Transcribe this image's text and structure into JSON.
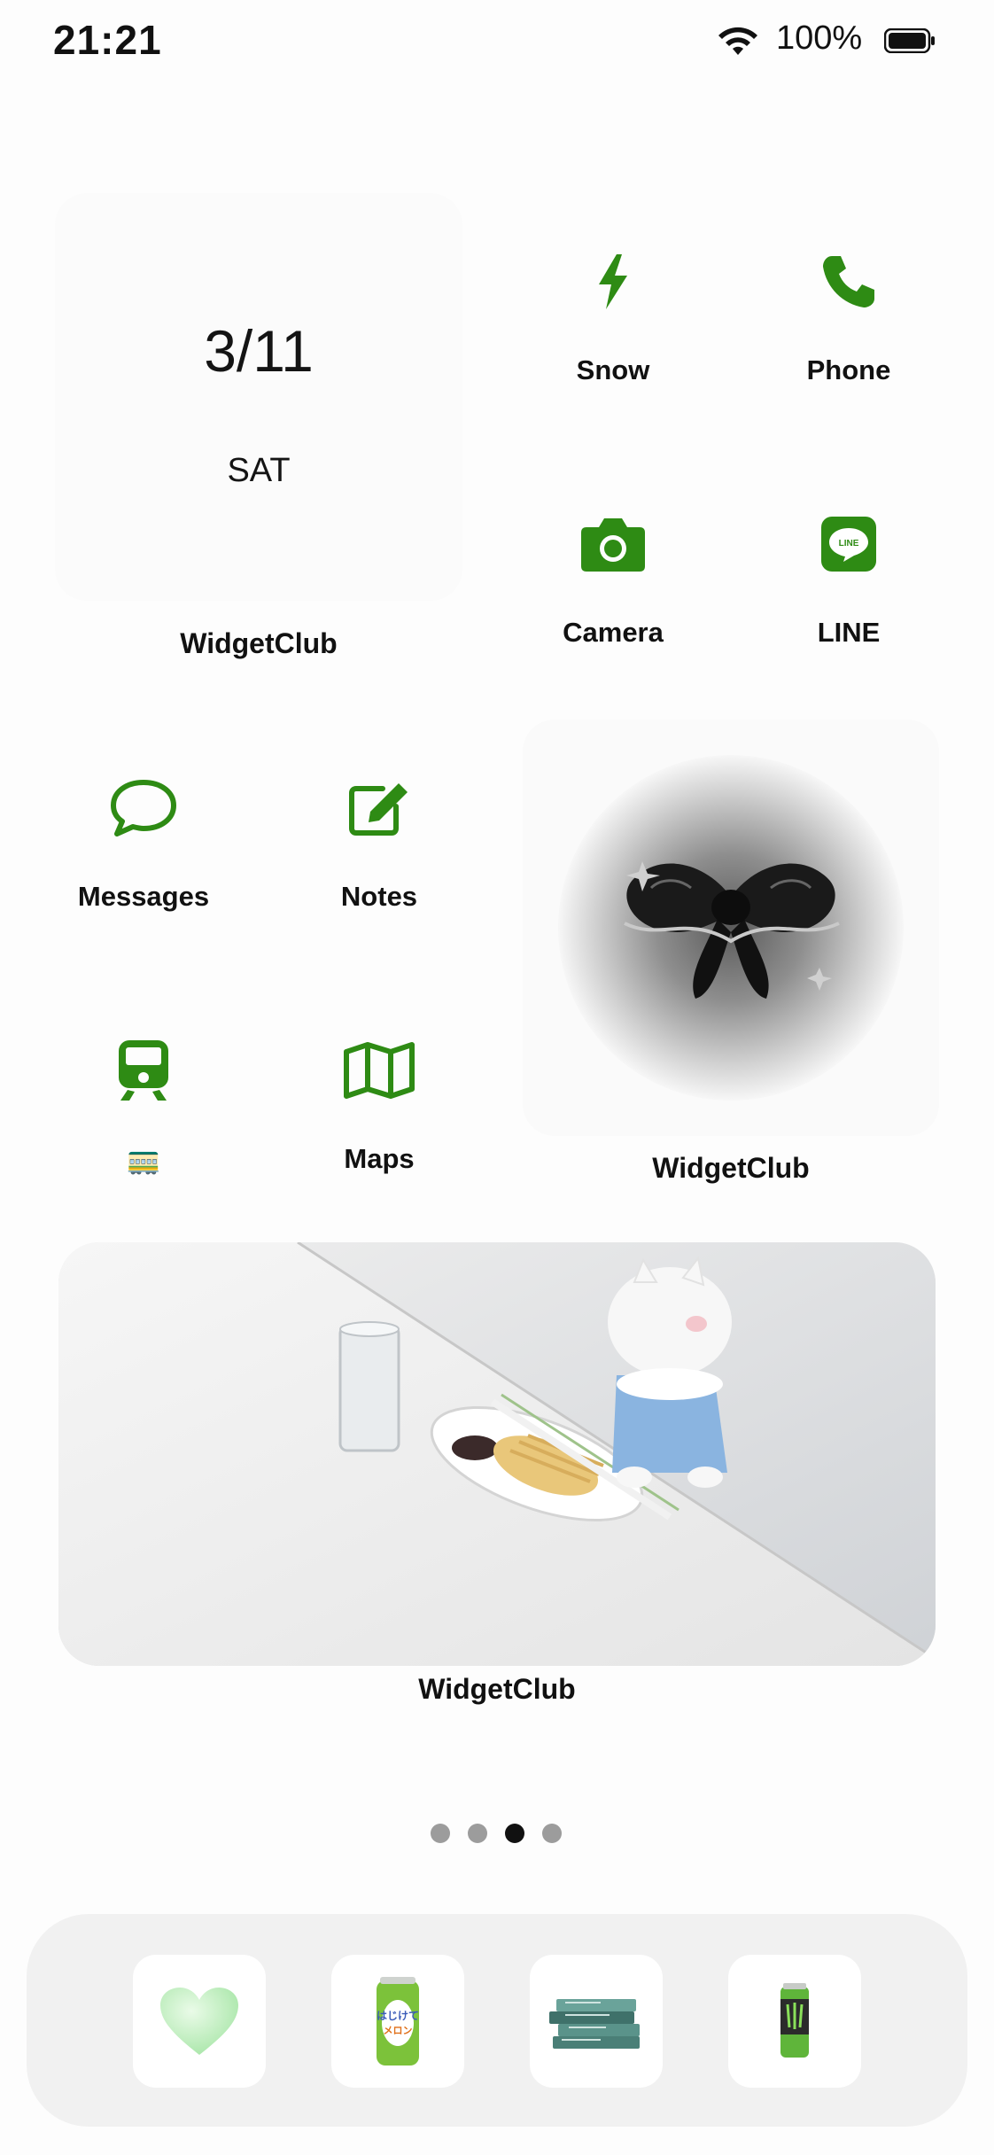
{
  "status_bar": {
    "time": "21:21",
    "battery_percent": "100%"
  },
  "date_widget": {
    "date": "3/11",
    "day": "SAT",
    "label": "WidgetClub"
  },
  "apps_top": [
    {
      "label": "Snow",
      "icon": "bolt-icon"
    },
    {
      "label": "Phone",
      "icon": "phone-icon"
    },
    {
      "label": "Camera",
      "icon": "camera-icon"
    },
    {
      "label": "LINE",
      "icon": "line-icon"
    }
  ],
  "apps_middle": [
    {
      "label": "Messages",
      "icon": "speech-bubble-icon"
    },
    {
      "label": "Notes",
      "icon": "note-pencil-icon"
    },
    {
      "label": "🚃",
      "icon": "train-icon"
    },
    {
      "label": "Maps",
      "icon": "map-icon"
    }
  ],
  "bow_widget": {
    "label": "WidgetClub"
  },
  "photo_widget": {
    "label": "WidgetClub"
  },
  "page_dots": {
    "count": 4,
    "active_index": 2
  },
  "dock": [
    {
      "icon": "green-heart-icon"
    },
    {
      "icon": "melon-soda-can-icon"
    },
    {
      "icon": "book-stack-icon"
    },
    {
      "icon": "energy-drink-can-icon"
    }
  ],
  "colors": {
    "accent_green": "#2e8b14",
    "background": "#fdfdfd",
    "dock_bg": "#f1f1f1"
  }
}
